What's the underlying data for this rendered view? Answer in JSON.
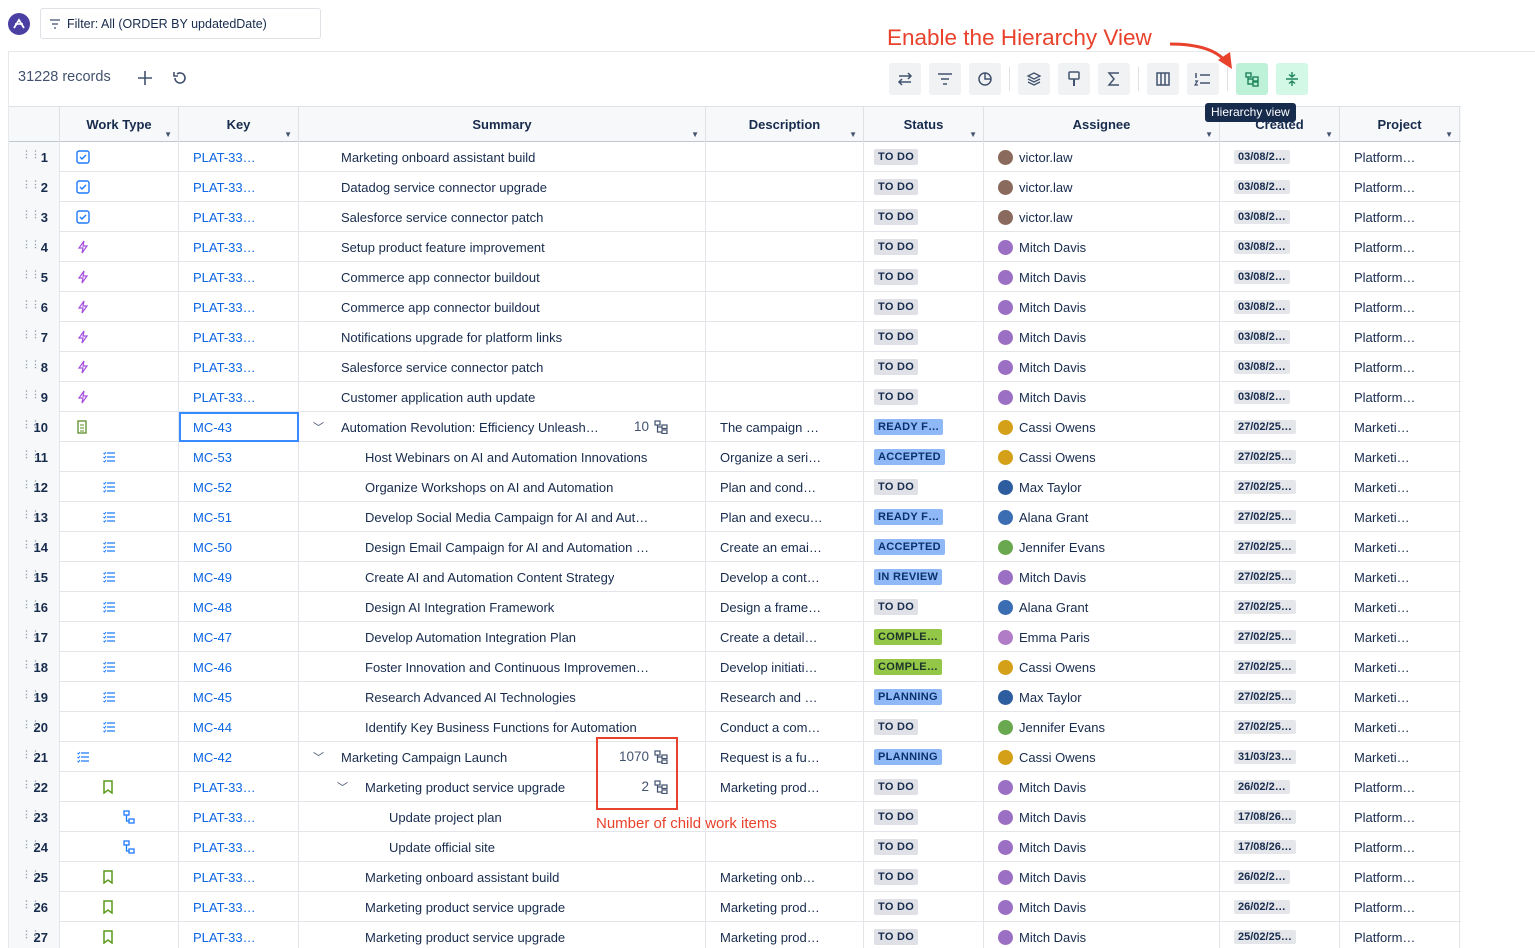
{
  "filter": {
    "label": "Filter: All (ORDER BY updatedDate)"
  },
  "records_label": "31228 records",
  "annotation": {
    "title": "Enable the Hierarchy View",
    "note": "Number of child work items"
  },
  "tooltip": "Hierarchy view",
  "columns": [
    "Work Type",
    "Key",
    "Summary",
    "Description",
    "Status",
    "Assignee",
    "Created",
    "Project"
  ],
  "toolbar_icons": [
    "swap-icon",
    "filter-icon",
    "chart-icon",
    "layers-icon",
    "paint-icon",
    "sum-icon",
    "columns-icon",
    "numbered-list-icon",
    "hierarchy-icon",
    "collapse-icon"
  ],
  "rows": [
    {
      "n": "1",
      "type": "task",
      "level": 0,
      "key": "PLAT-33…",
      "summary": "Marketing onboard assistant build",
      "desc": "",
      "status": "TO DO",
      "st": "todo",
      "assignee": "victor.law",
      "av": "#8a6a5c",
      "created": "03/08/2…",
      "project": "Platform…"
    },
    {
      "n": "2",
      "type": "task",
      "level": 0,
      "key": "PLAT-33…",
      "summary": "Datadog service connector upgrade",
      "desc": "",
      "status": "TO DO",
      "st": "todo",
      "assignee": "victor.law",
      "av": "#8a6a5c",
      "created": "03/08/2…",
      "project": "Platform…"
    },
    {
      "n": "3",
      "type": "task",
      "level": 0,
      "key": "PLAT-33…",
      "summary": "Salesforce service connector patch",
      "desc": "",
      "status": "TO DO",
      "st": "todo",
      "assignee": "victor.law",
      "av": "#8a6a5c",
      "created": "03/08/2…",
      "project": "Platform…"
    },
    {
      "n": "4",
      "type": "bolt",
      "level": 0,
      "key": "PLAT-33…",
      "summary": "Setup product feature improvement",
      "desc": "",
      "status": "TO DO",
      "st": "todo",
      "assignee": "Mitch Davis",
      "av": "#9b6fc4",
      "created": "03/08/2…",
      "project": "Platform…"
    },
    {
      "n": "5",
      "type": "bolt",
      "level": 0,
      "key": "PLAT-33…",
      "summary": "Commerce app connector buildout",
      "desc": "",
      "status": "TO DO",
      "st": "todo",
      "assignee": "Mitch Davis",
      "av": "#9b6fc4",
      "created": "03/08/2…",
      "project": "Platform…"
    },
    {
      "n": "6",
      "type": "bolt",
      "level": 0,
      "key": "PLAT-33…",
      "summary": "Commerce app connector buildout",
      "desc": "",
      "status": "TO DO",
      "st": "todo",
      "assignee": "Mitch Davis",
      "av": "#9b6fc4",
      "created": "03/08/2…",
      "project": "Platform…"
    },
    {
      "n": "7",
      "type": "bolt",
      "level": 0,
      "key": "PLAT-33…",
      "summary": "Notifications upgrade for platform links",
      "desc": "",
      "status": "TO DO",
      "st": "todo",
      "assignee": "Mitch Davis",
      "av": "#9b6fc4",
      "created": "03/08/2…",
      "project": "Platform…"
    },
    {
      "n": "8",
      "type": "bolt",
      "level": 0,
      "key": "PLAT-33…",
      "summary": "Salesforce service connector patch",
      "desc": "",
      "status": "TO DO",
      "st": "todo",
      "assignee": "Mitch Davis",
      "av": "#9b6fc4",
      "created": "03/08/2…",
      "project": "Platform…"
    },
    {
      "n": "9",
      "type": "bolt",
      "level": 0,
      "key": "PLAT-33…",
      "summary": "Customer application auth update",
      "desc": "",
      "status": "TO DO",
      "st": "todo",
      "assignee": "Mitch Davis",
      "av": "#9b6fc4",
      "created": "03/08/2…",
      "project": "Platform…"
    },
    {
      "n": "10",
      "type": "doc",
      "level": 0,
      "expand": true,
      "count": "10",
      "key": "MC-43",
      "selected": true,
      "summary": "Automation Revolution: Efficiency Unleash…",
      "desc": "The campaign …",
      "status": "READY F…",
      "st": "ready",
      "assignee": "Cassi Owens",
      "av": "#d4a017",
      "created": "27/02/25…",
      "project": "Marketi…"
    },
    {
      "n": "11",
      "type": "sub",
      "level": 1,
      "key": "MC-53",
      "summary": "Host Webinars on AI and Automation Innovations",
      "desc": "Organize a seri…",
      "status": "ACCEPTED",
      "st": "accepted",
      "assignee": "Cassi Owens",
      "av": "#d4a017",
      "created": "27/02/25…",
      "project": "Marketi…"
    },
    {
      "n": "12",
      "type": "sub",
      "level": 1,
      "key": "MC-52",
      "summary": "Organize Workshops on AI and Automation",
      "desc": "Plan and cond…",
      "status": "TO DO",
      "st": "todo",
      "assignee": "Max Taylor",
      "av": "#2d5d9f",
      "created": "27/02/25…",
      "project": "Marketi…"
    },
    {
      "n": "13",
      "type": "sub",
      "level": 1,
      "key": "MC-51",
      "summary": "Develop Social Media Campaign for AI and Aut…",
      "desc": "Plan and execu…",
      "status": "READY F…",
      "st": "ready",
      "assignee": "Alana Grant",
      "av": "#3b6db3",
      "created": "27/02/25…",
      "project": "Marketi…"
    },
    {
      "n": "14",
      "type": "sub",
      "level": 1,
      "key": "MC-50",
      "summary": "Design Email Campaign for AI and Automation …",
      "desc": "Create an emai…",
      "status": "ACCEPTED",
      "st": "accepted",
      "assignee": "Jennifer Evans",
      "av": "#6aa84f",
      "created": "27/02/25…",
      "project": "Marketi…"
    },
    {
      "n": "15",
      "type": "sub",
      "level": 1,
      "key": "MC-49",
      "summary": "Create AI and Automation Content Strategy",
      "desc": "Develop a cont…",
      "status": "IN REVIEW",
      "st": "review",
      "assignee": "Mitch Davis",
      "av": "#9b6fc4",
      "created": "27/02/25…",
      "project": "Marketi…"
    },
    {
      "n": "16",
      "type": "sub",
      "level": 1,
      "key": "MC-48",
      "summary": "Design AI Integration Framework",
      "desc": "Design a frame…",
      "status": "TO DO",
      "st": "todo",
      "assignee": "Alana Grant",
      "av": "#3b6db3",
      "created": "27/02/25…",
      "project": "Marketi…"
    },
    {
      "n": "17",
      "type": "sub",
      "level": 1,
      "key": "MC-47",
      "summary": "Develop Automation Integration Plan",
      "desc": "Create a detail…",
      "status": "COMPLE…",
      "st": "complete",
      "assignee": "Emma Paris",
      "av": "#b07cc6",
      "created": "27/02/25…",
      "project": "Marketi…"
    },
    {
      "n": "18",
      "type": "sub",
      "level": 1,
      "key": "MC-46",
      "summary": "Foster Innovation and Continuous Improvemen…",
      "desc": "Develop initiati…",
      "status": "COMPLE…",
      "st": "complete",
      "assignee": "Cassi Owens",
      "av": "#d4a017",
      "created": "27/02/25…",
      "project": "Marketi…"
    },
    {
      "n": "19",
      "type": "sub",
      "level": 1,
      "key": "MC-45",
      "summary": "Research Advanced AI Technologies",
      "desc": "Research and …",
      "status": "PLANNING",
      "st": "planning",
      "assignee": "Max Taylor",
      "av": "#2d5d9f",
      "created": "27/02/25…",
      "project": "Marketi…"
    },
    {
      "n": "20",
      "type": "sub",
      "level": 1,
      "key": "MC-44",
      "summary": "Identify Key Business Functions for Automation",
      "desc": "Conduct a com…",
      "status": "TO DO",
      "st": "todo",
      "assignee": "Jennifer Evans",
      "av": "#6aa84f",
      "created": "27/02/25…",
      "project": "Marketi…"
    },
    {
      "n": "21",
      "type": "sub",
      "level": 0,
      "expand": true,
      "count": "1070",
      "key": "MC-42",
      "summary": "Marketing Campaign Launch",
      "desc": "Request is a fu…",
      "status": "PLANNING",
      "st": "planning",
      "assignee": "Cassi Owens",
      "av": "#d4a017",
      "created": "31/03/23…",
      "project": "Marketi…"
    },
    {
      "n": "22",
      "type": "story",
      "level": 1,
      "expand": true,
      "count": "2",
      "key": "PLAT-33…",
      "summary": "Marketing product service upgrade",
      "desc": "Marketing prod…",
      "status": "TO DO",
      "st": "todo",
      "assignee": "Mitch Davis",
      "av": "#9b6fc4",
      "created": "26/02/2…",
      "project": "Platform…"
    },
    {
      "n": "23",
      "type": "subtask",
      "level": 2,
      "key": "PLAT-33…",
      "summary": "Update project plan",
      "desc": "",
      "status": "TO DO",
      "st": "todo",
      "assignee": "Mitch Davis",
      "av": "#9b6fc4",
      "created": "17/08/26…",
      "project": "Platform…"
    },
    {
      "n": "24",
      "type": "subtask",
      "level": 2,
      "key": "PLAT-33…",
      "summary": "Update official site",
      "desc": "",
      "status": "TO DO",
      "st": "todo",
      "assignee": "Mitch Davis",
      "av": "#9b6fc4",
      "created": "17/08/26…",
      "project": "Platform…"
    },
    {
      "n": "25",
      "type": "story",
      "level": 1,
      "key": "PLAT-33…",
      "summary": "Marketing onboard assistant build",
      "desc": "Marketing onb…",
      "status": "TO DO",
      "st": "todo",
      "assignee": "Mitch Davis",
      "av": "#9b6fc4",
      "created": "26/02/2…",
      "project": "Platform…"
    },
    {
      "n": "26",
      "type": "story",
      "level": 1,
      "key": "PLAT-33…",
      "summary": "Marketing product service upgrade",
      "desc": "Marketing prod…",
      "status": "TO DO",
      "st": "todo",
      "assignee": "Mitch Davis",
      "av": "#9b6fc4",
      "created": "26/02/2…",
      "project": "Platform…"
    },
    {
      "n": "27",
      "type": "story",
      "level": 1,
      "key": "PLAT-33…",
      "summary": "Marketing product service upgrade",
      "desc": "Marketing prod…",
      "status": "TO DO",
      "st": "todo",
      "assignee": "Mitch Davis",
      "av": "#9b6fc4",
      "created": "25/02/25…",
      "project": "Platform…"
    }
  ]
}
